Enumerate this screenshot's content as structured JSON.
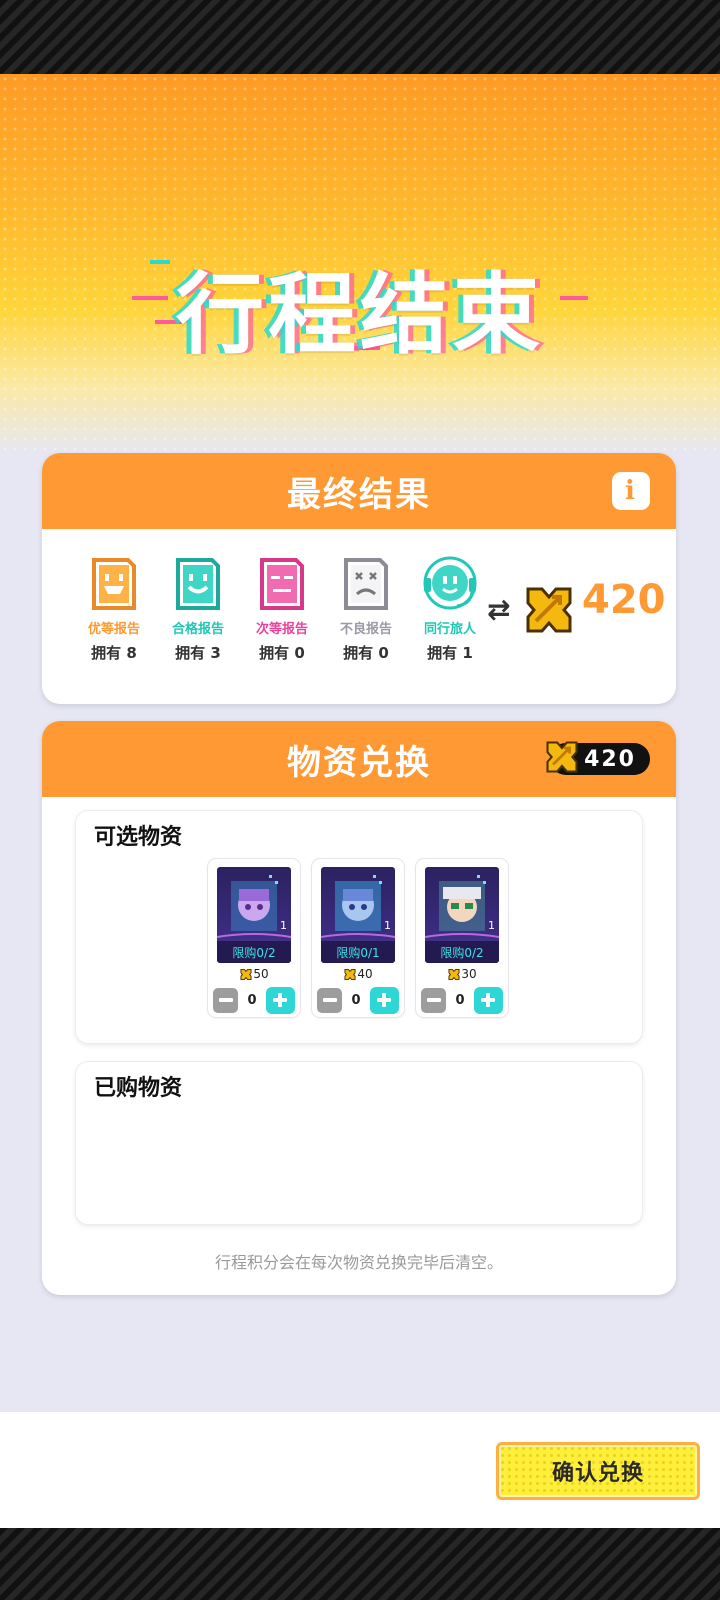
{
  "hero": {
    "title": "行程结束"
  },
  "result": {
    "title": "最终结果",
    "info_icon": "info-icon",
    "reports": [
      {
        "label": "优等报告",
        "owned": "拥有 8",
        "color": "#ff9933"
      },
      {
        "label": "合格报告",
        "owned": "拥有 3",
        "color": "#20c6b6"
      },
      {
        "label": "次等报告",
        "owned": "拥有 0",
        "color": "#e8459a"
      },
      {
        "label": "不良报告",
        "owned": "拥有 0",
        "color": "#9a9aa6"
      },
      {
        "label": "同行旅人",
        "owned": "拥有 1",
        "color": "#20c6b6"
      }
    ],
    "swap_icon": "exchange-arrows-icon",
    "total_points": "420"
  },
  "exchange": {
    "title": "物资兑换",
    "balance": "420",
    "available": {
      "title": "可选物资",
      "items": [
        {
          "count": "1",
          "limit": "限购0/2",
          "price": "50",
          "qty": "0"
        },
        {
          "count": "1",
          "limit": "限购0/1",
          "price": "40",
          "qty": "0"
        },
        {
          "count": "1",
          "limit": "限购0/2",
          "price": "30",
          "qty": "0"
        }
      ]
    },
    "purchased": {
      "title": "已购物资"
    },
    "note": "行程积分会在每次物资兑换完毕后清空。"
  },
  "footer": {
    "confirm_label": "确认兑换"
  }
}
